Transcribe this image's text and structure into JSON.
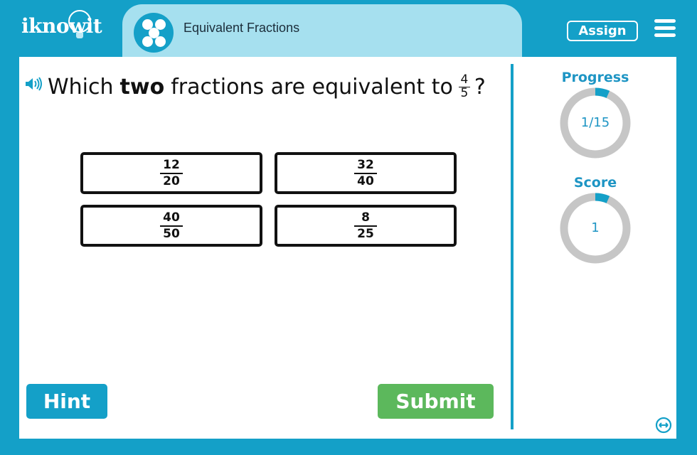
{
  "header": {
    "logo": "iknowit",
    "tab_title": "Equivalent Fractions",
    "assign_label": "Assign"
  },
  "question": {
    "prefix": "Which",
    "emphasis": "two",
    "suffix": "fractions are equivalent to",
    "target_numerator": "4",
    "target_denominator": "5",
    "end": "?"
  },
  "choices": [
    {
      "numerator": "12",
      "denominator": "20"
    },
    {
      "numerator": "32",
      "denominator": "40"
    },
    {
      "numerator": "40",
      "denominator": "50"
    },
    {
      "numerator": "8",
      "denominator": "25"
    }
  ],
  "buttons": {
    "hint": "Hint",
    "submit": "Submit"
  },
  "sidebar": {
    "progress_label": "Progress",
    "progress_value": "1/15",
    "progress_fraction": 0.0667,
    "score_label": "Score",
    "score_value": "1",
    "score_fraction": 0.0667
  },
  "colors": {
    "brand": "#14a0c8",
    "tab": "#a6e0ef",
    "submit": "#5cb85c",
    "ring_track": "#c6c6c6"
  },
  "icons": [
    "speaker-icon",
    "menu-icon",
    "expand-icon",
    "activity-icon"
  ]
}
